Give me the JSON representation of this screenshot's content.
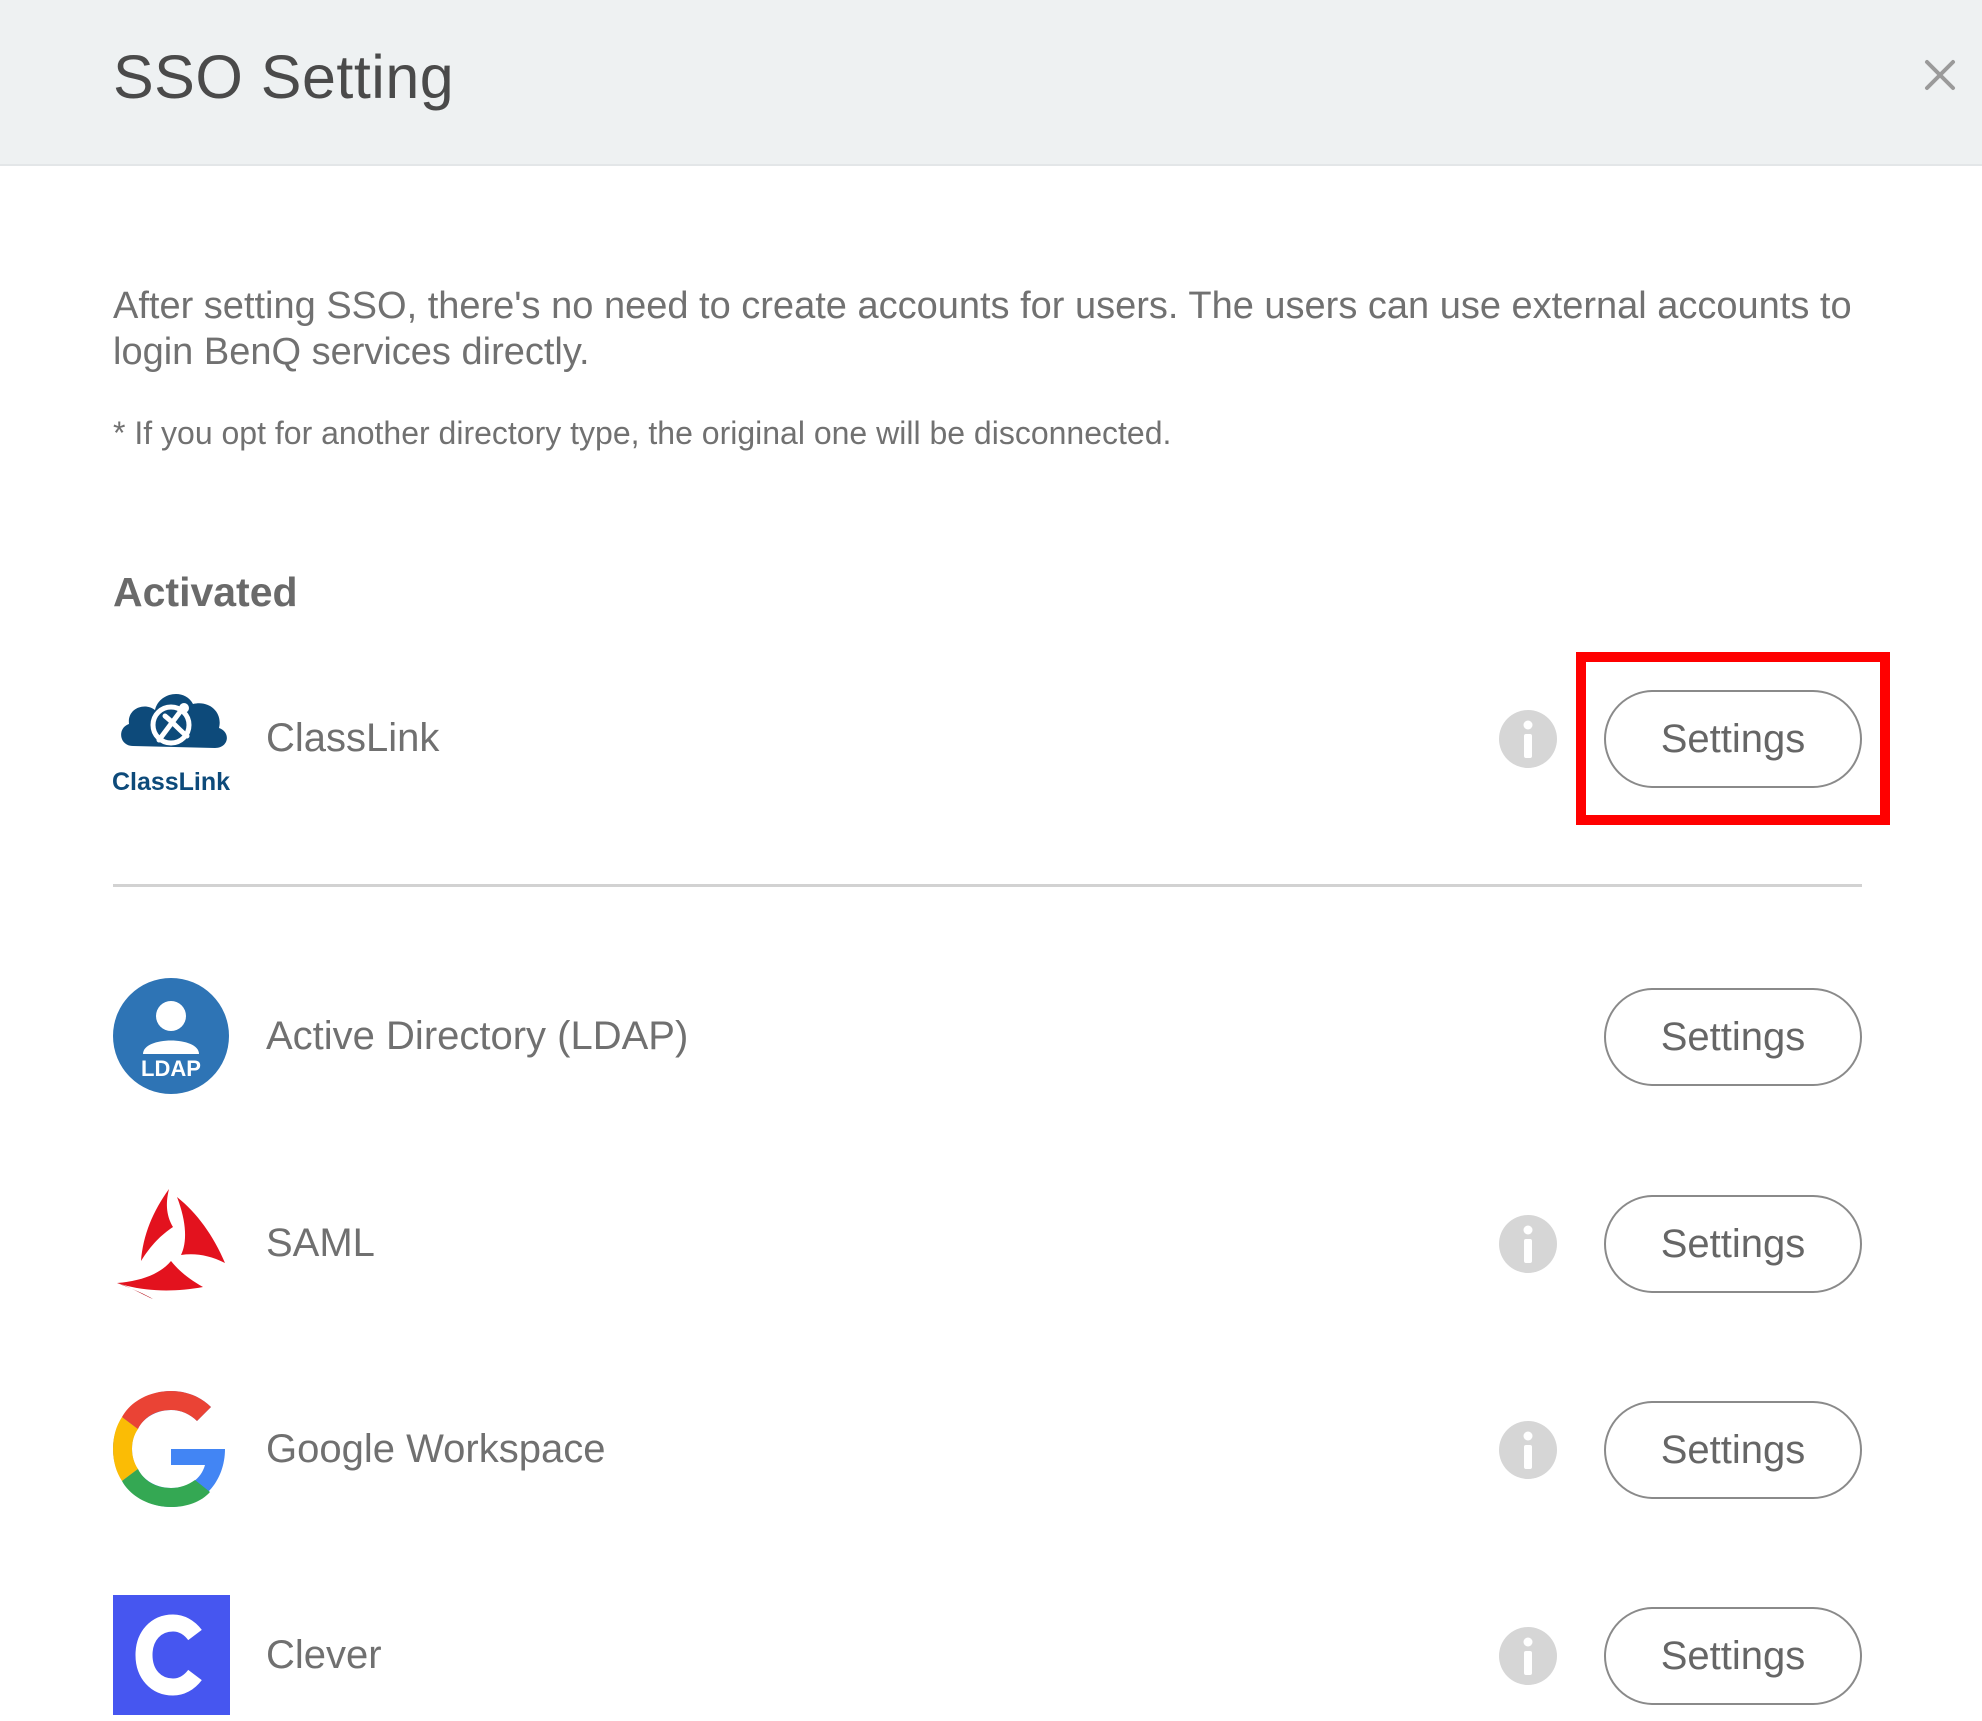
{
  "dialog": {
    "title": "SSO Setting",
    "close_label": "×"
  },
  "description": "After setting SSO, there's no need to create accounts for users. The users can use external accounts to login BenQ services directly.",
  "note": "* If you opt for another directory type, the original one will be disconnected.",
  "activated_section": {
    "title": "Activated"
  },
  "providers": [
    {
      "name": "ClassLink",
      "logo_text": "ClassLink",
      "icon": "classlink-logo",
      "has_info": true,
      "button_label": "Settings",
      "activated": true
    },
    {
      "name": "Active Directory (LDAP)",
      "logo_text": "LDAP",
      "icon": "ldap-logo",
      "has_info": false,
      "button_label": "Settings",
      "activated": false
    },
    {
      "name": "SAML",
      "icon": "saml-logo",
      "has_info": true,
      "button_label": "Settings",
      "activated": false
    },
    {
      "name": "Google Workspace",
      "icon": "google-logo",
      "has_info": true,
      "button_label": "Settings",
      "activated": false
    },
    {
      "name": "Clever",
      "icon": "clever-logo",
      "has_info": true,
      "button_label": "Settings",
      "activated": false
    }
  ],
  "colors": {
    "header_bg": "#eef1f2",
    "highlight": "#ff0000",
    "classlink_blue": "#0d4a7a",
    "ldap_blue": "#2e74b5",
    "saml_red": "#e3121e",
    "clever_blue": "#4656f0"
  }
}
